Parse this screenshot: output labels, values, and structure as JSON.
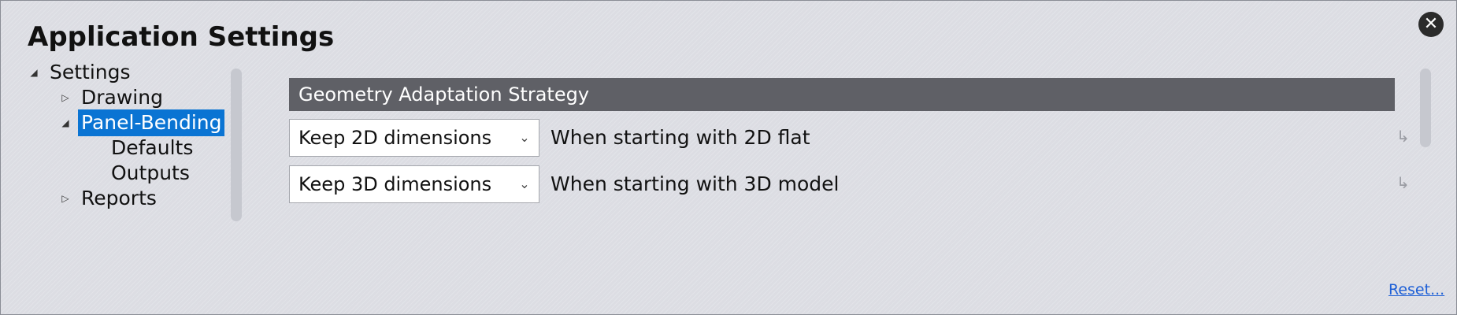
{
  "dialog": {
    "title": "Application Settings",
    "close_icon": "close-icon"
  },
  "tree": {
    "root": "Settings",
    "drawing": "Drawing",
    "panel_bending": "Panel-Bending",
    "defaults": "Defaults",
    "outputs": "Outputs",
    "reports": "Reports",
    "expanded_glyph": "◢",
    "collapsed_glyph": "▷"
  },
  "content": {
    "section_title": "Geometry Adaptation Strategy",
    "rows": [
      {
        "value": "Keep 2D dimensions",
        "label": "When starting with 2D flat"
      },
      {
        "value": "Keep 3D dimensions",
        "label": "When starting with 3D model"
      }
    ],
    "chevron_glyph": "⌄",
    "corner_glyph": "↳"
  },
  "footer": {
    "reset_label": "Reset..."
  },
  "colors": {
    "selection": "#0a74d3",
    "header_bg": "#5f6066",
    "link": "#1d5fd6",
    "background": "#dcdde3"
  }
}
